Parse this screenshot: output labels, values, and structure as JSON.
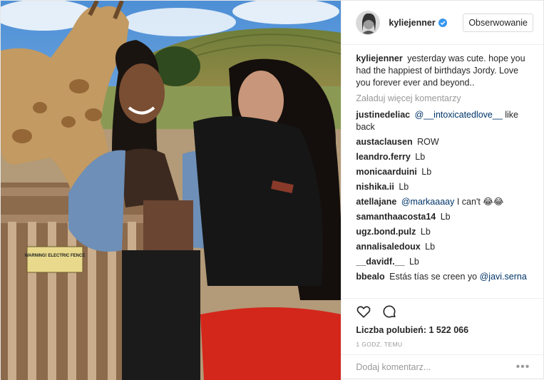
{
  "header": {
    "username": "kyliejenner",
    "follow_label": "Obserwowanie"
  },
  "caption": {
    "user": "kyliejenner",
    "text": "yesterday was cute. hope you had the happiest of birthdays Jordy. Love you forever ever and beyond.."
  },
  "load_more": "Załaduj więcej komentarzy",
  "comments": [
    {
      "user": "justinedeliac",
      "mention": "@__intoxicatedlove__",
      "text": " like back"
    },
    {
      "user": "austaclausen",
      "text": "ROW"
    },
    {
      "user": "leandro.ferry",
      "text": "Lb"
    },
    {
      "user": "monicaarduini",
      "text": "Lb"
    },
    {
      "user": "nishika.ii",
      "text": "Lb"
    },
    {
      "user": "atellajane",
      "mention": "@markaaaay",
      "text": " I can't 😂😂"
    },
    {
      "user": "samanthaacosta14",
      "text": "Lb"
    },
    {
      "user": "ugz.bond.pulz",
      "text": "Lb"
    },
    {
      "user": "annalisaledoux",
      "text": "Lb"
    },
    {
      "user": "__davidf.__",
      "text": "Lb"
    },
    {
      "user": "bbealo",
      "text": "Estás tías se creen yo ",
      "mention": "@javi.serna"
    }
  ],
  "likes": {
    "label": "Liczba polubień:",
    "count": "1 522 066"
  },
  "time_ago": "1 GODZ. TEMU",
  "add_comment": {
    "placeholder": "Dodaj komentarz...",
    "more": "•••"
  },
  "icons": {
    "like": "heart-icon",
    "comment": "comment-bubble-icon",
    "verified": "verified-badge-icon",
    "options": "more-options-icon"
  },
  "photo": {
    "sign_text": "WARNING! ELECTRIC FENCE"
  },
  "colors": {
    "verified": "#3897f0",
    "mention": "#003569",
    "muted": "#999999",
    "border": "#efefef"
  }
}
